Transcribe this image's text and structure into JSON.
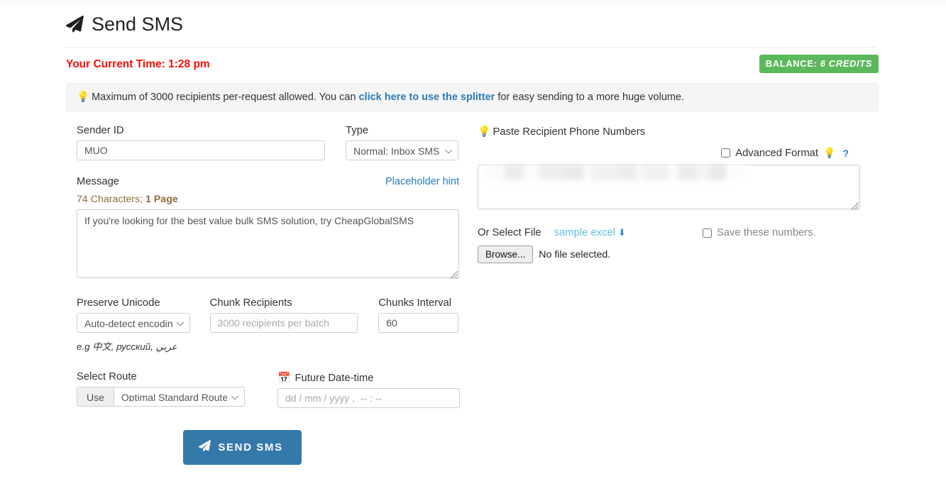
{
  "header": {
    "title": "Send SMS",
    "plane_icon": "paper-plane-icon"
  },
  "status": {
    "current_time_label": "Your Current Time: 1:28 pm",
    "balance_prefix": "BALANCE:",
    "balance_value": "6 CREDITS",
    "balance_color": "#5cb85c",
    "time_color": "#fb0c05"
  },
  "alert": {
    "bulb_icon": "lightbulb-icon",
    "text_before": "Maximum of 3000 recipients per-request allowed. You can",
    "link_text": "click here to use the splitter",
    "text_after": "for easy sending to a more huge volume.",
    "link_color": "#2b7cb8"
  },
  "form": {
    "sender_id_label": "Sender ID",
    "sender_id_value": "MUO",
    "type_label": "Type",
    "type_value": "Normal: Inbox SMS",
    "message_label": "Message",
    "placeholder_hint_link": "Placeholder hint",
    "char_count_text": "74 Characters;",
    "page_count_text": "1 Page",
    "message_value": "If you're looking for the best value bulk SMS solution, try CheapGlobalSMS",
    "preserve_unicode_label": "Preserve Unicode",
    "preserve_unicode_value": "Auto-detect encoding",
    "unicode_hint": "e.g 中文, русский, عربي",
    "chunk_recipients_label": "Chunk Recipients",
    "chunk_recipients_placeholder": "3000 recipients per batch",
    "chunk_recipients_value": "",
    "chunks_interval_label": "Chunks Interval",
    "chunks_interval_value": "60",
    "select_route_label": "Select Route",
    "route_use_addon": "Use",
    "route_value": "Optimal Standard Route",
    "future_datetime_label": "Future Date-time",
    "calendar_icon": "calendar-icon",
    "future_datetime_placeholder": "dd / mm / yyyy ,  -- : --",
    "send_button_label": "SEND SMS",
    "send_button_color": "#3579ab"
  },
  "recipients": {
    "paste_label": "Paste Recipient Phone Numbers",
    "bulb_icon": "lightbulb-icon",
    "advanced_format_label": "Advanced Format",
    "advanced_format_checked": false,
    "help_icon": "question-mark-icon",
    "textarea_value": "",
    "or_select_file_label": "Or Select File",
    "sample_excel_link": "sample excel",
    "download_icon": "download-icon",
    "save_numbers_label": "Save these numbers.",
    "save_numbers_checked": false,
    "browse_button_label": "Browse...",
    "no_file_text": "No file selected."
  }
}
